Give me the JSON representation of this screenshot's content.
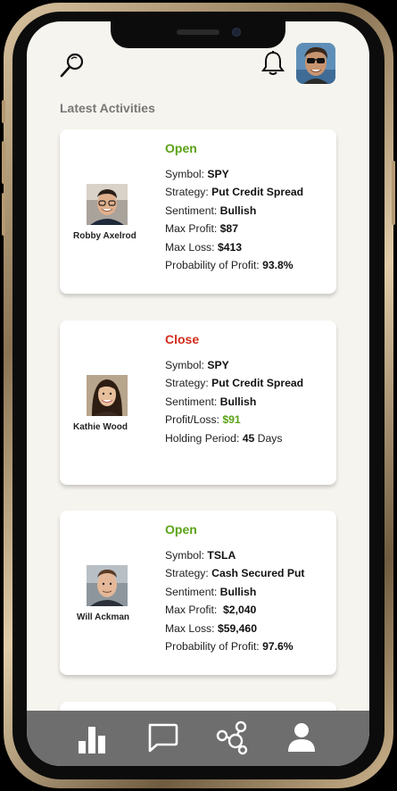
{
  "header": {
    "section_title": "Latest Activities",
    "icons": [
      "search-icon",
      "bell-icon",
      "profile-avatar"
    ]
  },
  "activities": [
    {
      "status": "Open",
      "trader": "Robby Axelrod",
      "lines": [
        {
          "label": "Symbol: ",
          "value": "SPY"
        },
        {
          "label": "Strategy: ",
          "value": "Put Credit Spread"
        },
        {
          "label": "Sentiment: ",
          "value": "Bullish"
        },
        {
          "label": "Max Profit: ",
          "value": "$87"
        },
        {
          "label": "Max Loss: ",
          "value": "$413"
        },
        {
          "label": "Probability of Profit: ",
          "value": "93.8%"
        }
      ]
    },
    {
      "status": "Close",
      "trader": "Kathie Wood",
      "lines": [
        {
          "label": "Symbol: ",
          "value": "SPY"
        },
        {
          "label": "Strategy: ",
          "value": "Put Credit Spread"
        },
        {
          "label": "Sentiment: ",
          "value": "Bullish"
        },
        {
          "label": "Profit/Loss: ",
          "value": "$91"
        },
        {
          "label": "Holding Period: ",
          "value": "45",
          "suffix": " Days"
        }
      ]
    },
    {
      "status": "Open",
      "trader": "Will Ackman",
      "lines": [
        {
          "label": "Symbol: ",
          "value": "TSLA"
        },
        {
          "label": "Strategy: ",
          "value": "Cash Secured Put"
        },
        {
          "label": "Sentiment: ",
          "value": "Bullish"
        },
        {
          "label": "Max Profit:  ",
          "value": "$2,040"
        },
        {
          "label": "Max Loss: ",
          "value": "$59,460"
        },
        {
          "label": "Probability of Profit: ",
          "value": "97.6%"
        }
      ]
    }
  ],
  "navbar": {
    "icons": [
      "bar-chart-icon",
      "chat-icon",
      "network-icon",
      "profile-icon"
    ],
    "background": "#6e6e6e"
  },
  "colors": {
    "open": "#5aa217",
    "close": "#d12c1c",
    "profit": "#5aa217",
    "screen_bg": "#f6f4ee"
  }
}
